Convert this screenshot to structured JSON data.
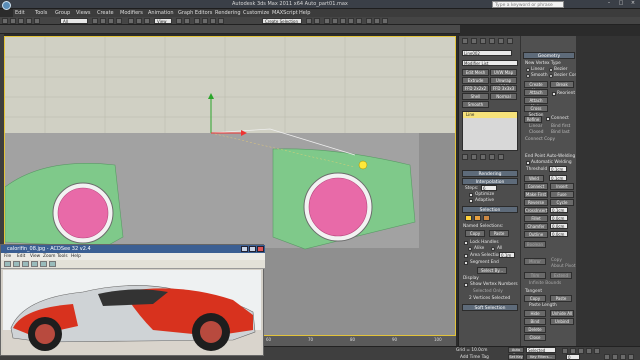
{
  "app": {
    "title": "Autodesk 3ds Max 2011 x64    Auto_part01.max",
    "search_placeholder": "Type a keyword or phrase"
  },
  "menu": [
    "Edit",
    "Tools",
    "Group",
    "Views",
    "Create",
    "Modifiers",
    "Animation",
    "Graph Editors",
    "Rendering",
    "Customize",
    "MAXScript",
    "Help"
  ],
  "toolbar": {
    "selection_filter": "All",
    "view_dropdown": "View",
    "selection_set": "Create Selection Set"
  },
  "viewport": {
    "label": "[ + ] [ Left ] [ Realistic + Edged Faces ]",
    "ruler_ticks": [
      "0",
      "10",
      "20",
      "30",
      "40",
      "50",
      "60",
      "70",
      "80",
      "90",
      "100"
    ]
  },
  "command_panel": {
    "object_name": "Line002",
    "modifier_list": "Modifier List",
    "modifiers": [
      [
        "Edit Mesh",
        "UVW Map"
      ],
      [
        "Extrude",
        "Unwrap UVW"
      ],
      [
        "FFD 2x2x2",
        "FFD 3x3x3"
      ],
      [
        "Shell",
        "Normal"
      ],
      [
        "Smooth",
        ""
      ]
    ],
    "stack_item": "Line",
    "rollouts": [
      "Rendering",
      "Interpolation",
      "Selection",
      "Soft Selection"
    ],
    "interpolation": {
      "steps_label": "Steps:",
      "steps_value": "6",
      "optimize": "Optimize",
      "adaptive": "Adaptive"
    },
    "selection": {
      "named_selections": "Named Selections:",
      "copy": "Copy",
      "paste": "Paste",
      "lock_handles": "Lock Handles",
      "alike": "Alike",
      "all": "All",
      "area_selection": "Area Selection:",
      "area_value": "0.1m",
      "segment_end": "Segment End",
      "select_by": "Select By...",
      "display": "Display",
      "show_vertex_numbers": "Show Vertex Numbers",
      "selected_only": "Selected Only",
      "status": "2 Vertices Selected"
    }
  },
  "geometry_panel": {
    "title": "Geometry",
    "new_vertex_type": "New Vertex Type",
    "types": [
      "Linear",
      "Bezier",
      "Smooth",
      "Bezier Corner"
    ],
    "buttons1": [
      [
        "Create Line",
        "Break"
      ],
      [
        "Attach",
        ""
      ],
      [
        "Attach Mult.",
        ""
      ],
      [
        "Cross Section",
        ""
      ]
    ],
    "reorient": "Reorient",
    "refine": "Refine",
    "connect": "Connect",
    "linear": "Linear",
    "bind_first": "Bind first",
    "closed": "Closed",
    "bind_last": "Bind last",
    "connect_copy": "Connect Copy",
    "threshold": "Threshold",
    "end_point_auto": "End Point Auto-Welding",
    "auto_welding": "Automatic Welding",
    "threshold_value": "0.1cm",
    "buttons2": [
      [
        "Weld",
        ""
      ],
      [
        "Connect",
        "Insert"
      ],
      [
        "Make First",
        "Fuse"
      ],
      [
        "Reverse",
        "Cycle"
      ],
      [
        "CrossInsert",
        ""
      ],
      [
        "Fillet",
        ""
      ],
      [
        "Chamfer",
        ""
      ],
      [
        "Outline",
        ""
      ]
    ],
    "weld_value": "0.1cm",
    "crossinsert_value": "0.1cm",
    "fillet_value": "0.0cm",
    "chamfer_value": "0.0cm",
    "outline_value": "0.0cm",
    "boolean": "Boolean",
    "mirror": "Mirror",
    "copy": "Copy",
    "about_pivot": "About Pivot",
    "trim": "Trim",
    "extend": "Extend",
    "infinite_bounds": "Infinite Bounds",
    "tangent": "Tangent",
    "tan_copy": "Copy",
    "tan_paste": "Paste",
    "paste_length": "Paste Length",
    "hide": "Hide",
    "unhide_all": "Unhide All",
    "bind": "Bind",
    "unbind": "Unbind",
    "delete": "Delete",
    "close": "Close"
  },
  "status_bar": {
    "grid": "Grid = 10.0cm",
    "auto_key": "Auto Key",
    "set_key": "Set Key",
    "selected": "Selected",
    "key_filters": "Key Filters...",
    "add_time_tag": "Add Time Tag",
    "frame": "0"
  },
  "image_viewer": {
    "title": "calorifin_08.jpg - ACDSee 32 v2.4",
    "menu": [
      "File",
      "Edit",
      "View",
      "Zoom",
      "Tools",
      "Help"
    ]
  },
  "colors": {
    "viewport_bg": "#8f8f8f",
    "car_body": "#7fc98a",
    "wheel": "#e86aa8",
    "selected_yellow": "#e2c33b",
    "rollout_blue": "#5e6b7a"
  }
}
